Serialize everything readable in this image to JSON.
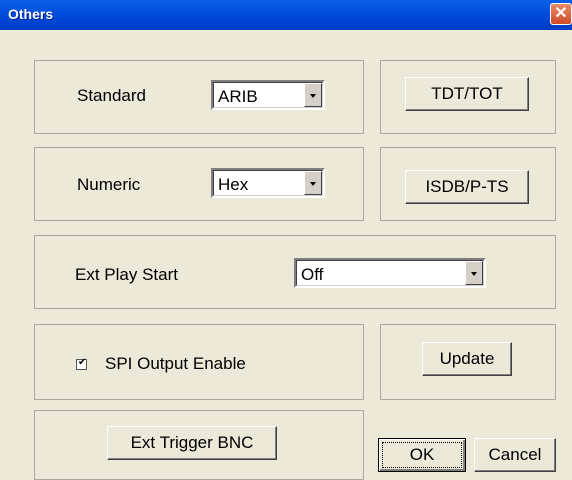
{
  "window": {
    "title": "Others",
    "close_glyph": "✕"
  },
  "standard": {
    "label": "Standard",
    "value": "ARIB"
  },
  "numeric": {
    "label": "Numeric",
    "value": "Hex"
  },
  "ext_play_start": {
    "label": "Ext Play Start",
    "value": "Off"
  },
  "spi": {
    "label": "SPI Output Enable",
    "checked": true
  },
  "buttons": {
    "tdt_tot": "TDT/TOT",
    "isdb_pts": "ISDB/P-TS",
    "update": "Update",
    "ext_trigger": "Ext Trigger BNC",
    "ok": "OK",
    "cancel": "Cancel"
  }
}
